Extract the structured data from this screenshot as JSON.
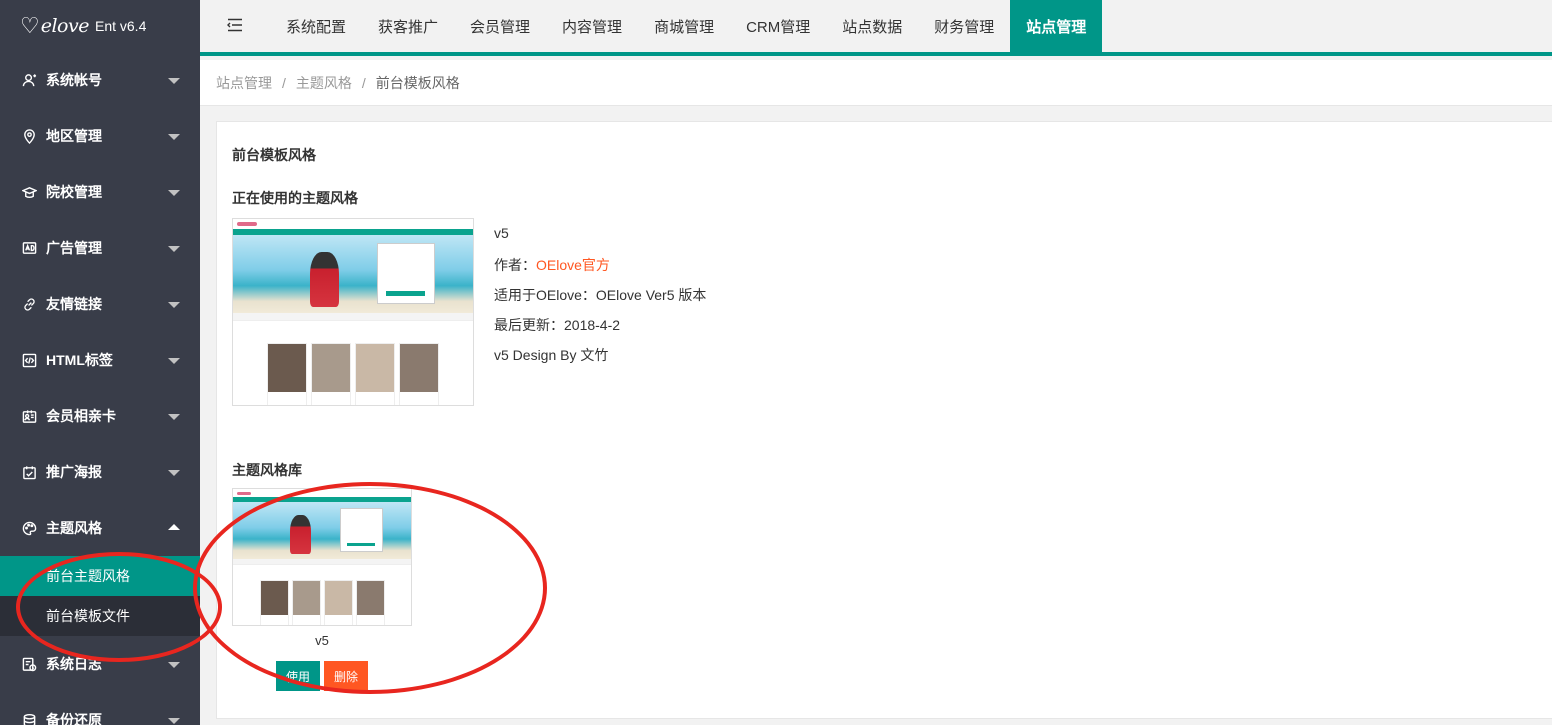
{
  "app": {
    "logo_text": "elove",
    "version": "Ent v6.4"
  },
  "sidebar": {
    "items": [
      {
        "label": "系统帐号",
        "icon": "user-icon"
      },
      {
        "label": "地区管理",
        "icon": "location-icon"
      },
      {
        "label": "院校管理",
        "icon": "graduation-cap-icon"
      },
      {
        "label": "广告管理",
        "icon": "ad-icon"
      },
      {
        "label": "友情链接",
        "icon": "link-icon"
      },
      {
        "label": "HTML标签",
        "icon": "code-icon"
      },
      {
        "label": "会员相亲卡",
        "icon": "id-card-icon"
      },
      {
        "label": "推广海报",
        "icon": "poster-icon"
      },
      {
        "label": "主题风格",
        "icon": "palette-icon",
        "expanded": true
      },
      {
        "label": "系统日志",
        "icon": "log-icon"
      },
      {
        "label": "备份还原",
        "icon": "backup-icon"
      }
    ],
    "subitems": [
      {
        "label": "前台主题风格",
        "active": true
      },
      {
        "label": "前台模板文件",
        "active": false
      }
    ]
  },
  "topbar": {
    "toggle_icon": "menu-fold-icon",
    "tabs": [
      {
        "label": "系统配置"
      },
      {
        "label": "获客推广"
      },
      {
        "label": "会员管理"
      },
      {
        "label": "内容管理"
      },
      {
        "label": "商城管理"
      },
      {
        "label": "CRM管理"
      },
      {
        "label": "站点数据"
      },
      {
        "label": "财务管理"
      },
      {
        "label": "站点管理",
        "active": true
      }
    ]
  },
  "breadcrumb": {
    "items": [
      "站点管理",
      "主题风格",
      "前台模板风格"
    ],
    "separator": "/"
  },
  "main": {
    "card_title": "前台模板风格",
    "current_title": "正在使用的主题风格",
    "current": {
      "name": "v5",
      "author_label": "作者：",
      "author": "OElove官方",
      "compat": "适用于OElove：OElove Ver5 版本",
      "updated": "最后更新：2018-4-2",
      "design": "v5 Design By 文竹"
    },
    "library_title": "主题风格库",
    "library": [
      {
        "name": "v5",
        "use_label": "使用",
        "delete_label": "删除"
      }
    ]
  },
  "colors": {
    "accent": "#009688",
    "danger": "#ff5722",
    "sidebar_bg": "#393d49",
    "annotation": "#e8261f"
  }
}
